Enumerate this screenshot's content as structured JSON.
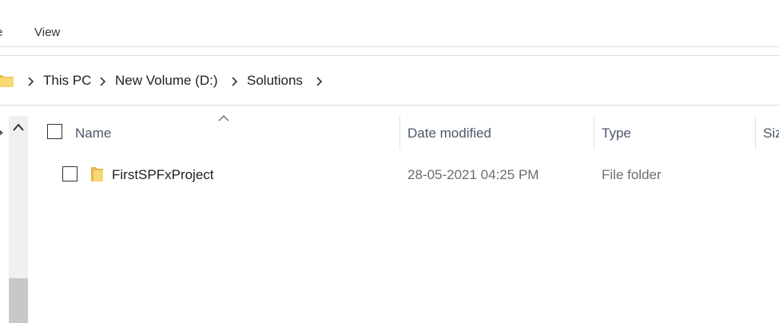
{
  "menu": {
    "tabs": [
      {
        "label": "e"
      },
      {
        "label": "View"
      }
    ]
  },
  "address_bar": {
    "breadcrumbs": [
      "This PC",
      "New Volume (D:)",
      "Solutions"
    ]
  },
  "file_list": {
    "columns": [
      "Name",
      "Date modified",
      "Type",
      "Siz"
    ],
    "sort_column": "Name",
    "rows": [
      {
        "name": "FirstSPFxProject",
        "date_modified": "28-05-2021 04:25 PM",
        "type": "File folder"
      }
    ]
  },
  "colors": {
    "folder_yellow": "#f8d775",
    "header_text": "#4b5968",
    "muted_text": "#6d6d6d"
  }
}
